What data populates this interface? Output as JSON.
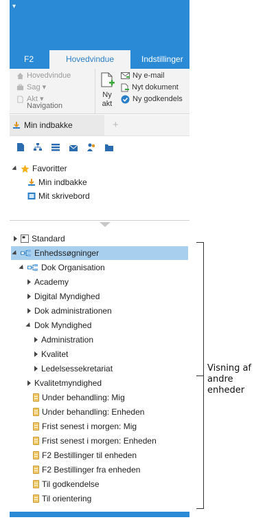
{
  "app": {
    "tabs": [
      "F2",
      "Hovedvindue",
      "Indstillinger"
    ],
    "active_tab": "Hovedvindue"
  },
  "ribbon": {
    "navigation": {
      "items": [
        "Hovedvindue",
        "Sag ▾",
        "Akt ▾"
      ],
      "group_label": "Navigation"
    },
    "new_act_label_1": "Ny",
    "new_act_label_2": "akt",
    "actions": [
      "Ny e-mail",
      "Nyt dokument",
      "Ny godkendels"
    ]
  },
  "inbox_tab": {
    "label": "Min indbakke",
    "add": "+"
  },
  "favorites": {
    "title": "Favoritter",
    "items": [
      "Min indbakke",
      "Mit skrivebord"
    ]
  },
  "tree": {
    "standard": "Standard",
    "unit_searches": "Enhedssøgninger",
    "dok_org": "Dok Organisation",
    "level2": [
      "Academy",
      "Digital Myndighed",
      "Dok administrationen",
      "Dok Myndighed"
    ],
    "dok_myndighed_children": [
      "Administration",
      "Kvalitet",
      "Ledelsessekretariat"
    ],
    "kvalitetmyndighed": "Kvalitetmyndighed",
    "searches": [
      "Under behandling: Mig",
      "Under behandling: Enheden",
      "Frist senest i morgen: Mig",
      "Frist senest i morgen: Enheden",
      "F2 Bestillinger til enheden",
      "F2 Bestillinger fra enheden",
      "Til godkendelse",
      "Til orientering"
    ]
  },
  "annotation": {
    "line1": "Visning af",
    "line2": "andre",
    "line3": "enheder"
  },
  "colors": {
    "title_bar": "#2b8ad6",
    "selection": "#a8d0ee",
    "ribbon_bg": "#f3f3f3"
  }
}
